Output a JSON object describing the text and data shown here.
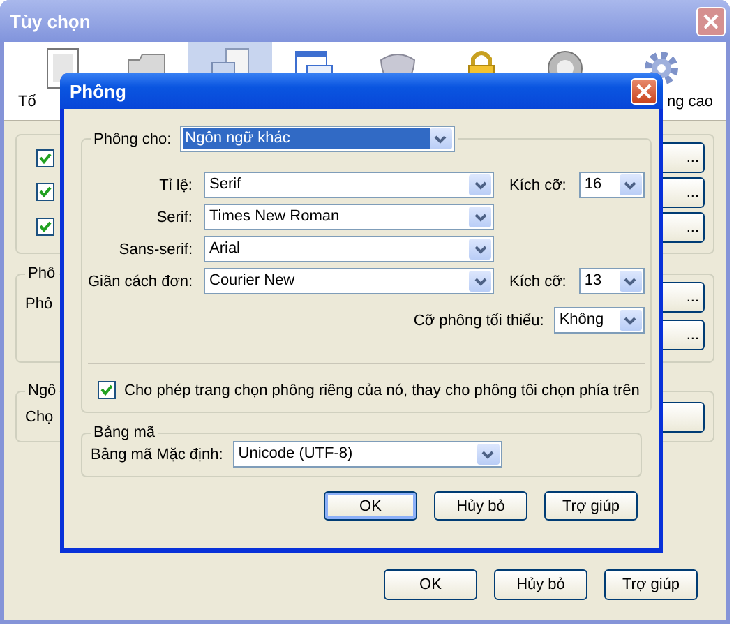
{
  "window": {
    "title": "Tùy chọn"
  },
  "toolbar": [
    {
      "label": "Tổ",
      "selected": false
    },
    {
      "selected": false
    },
    {
      "selected": true
    },
    {
      "selected": false
    },
    {
      "selected": false
    },
    {
      "selected": false
    },
    {
      "selected": false
    },
    {
      "label": "ng cao",
      "selected": false
    }
  ],
  "general_group": {
    "checkboxes": [
      {
        "checked": true
      },
      {
        "checked": true
      },
      {
        "checked": true
      }
    ],
    "buttons": [
      "...",
      "...",
      "..."
    ]
  },
  "fonts_group": {
    "title": "Phô",
    "label": "Phô",
    "buttons": [
      "...",
      "..."
    ]
  },
  "language_group": {
    "title": "Ngô",
    "label": "Chọ"
  },
  "buttons": [
    {
      "label": "OK",
      "default": false
    },
    {
      "label": "Hủy bỏ",
      "default": false
    },
    {
      "label": "Trợ giúp",
      "default": false
    }
  ],
  "dialog": {
    "title": "Phông",
    "font_for": {
      "label": "Phông cho:",
      "value": "Ngôn ngữ khác",
      "focused": true
    },
    "rows": [
      {
        "label": "Tỉ lệ:",
        "value": "Serif",
        "size_label": "Kích cỡ:",
        "size": "16"
      },
      {
        "label": "Serif:",
        "value": "Times New Roman"
      },
      {
        "label": "Sans-serif:",
        "value": "Arial"
      },
      {
        "label": "Giãn cách đơn:",
        "value": "Courier New",
        "size_label": "Kích cỡ:",
        "size": "13"
      }
    ],
    "min_size": {
      "label": "Cỡ phông tối thiểu:",
      "value": "Không"
    },
    "allow_page_fonts": {
      "label": "Cho phép trang chọn phông riêng của nó, thay cho phông tôi chọn phía trên",
      "checked": true
    },
    "encoding": {
      "title": "Bảng mã",
      "label": "Bảng mã Mặc định:",
      "value": "Unicode (UTF-8)"
    },
    "buttons": [
      {
        "label": "OK",
        "default": true
      },
      {
        "label": "Hủy bỏ",
        "default": false
      },
      {
        "label": "Trợ giúp",
        "default": false
      }
    ]
  }
}
